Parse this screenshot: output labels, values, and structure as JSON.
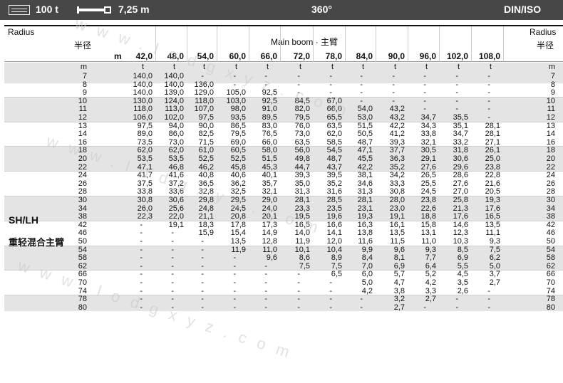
{
  "topbar": {
    "counterweight": "100 t",
    "boom_length": "7,25 m",
    "slewing": "360°",
    "standard": "DIN/ISO"
  },
  "header": {
    "radius_en_left": "Radius",
    "radius_cn_left": "半径",
    "radius_en_right": "Radius",
    "radius_cn_right": "半径",
    "main_boom": "Main boom · 主臂",
    "unit_m": "m",
    "unit_t": "t",
    "boom_lengths": [
      "42,0",
      "48,0",
      "54,0",
      "60,0",
      "66,0",
      "72,0",
      "78,0",
      "84,0",
      "90,0",
      "96,0",
      "102,0",
      "108,0"
    ]
  },
  "side_labels": {
    "config": "SH/LH",
    "config_cn": "重轻混合主臂"
  },
  "watermark": "www.lodgxyz.com",
  "table": {
    "radii": [
      "7",
      "8",
      "9",
      "10",
      "11",
      "12",
      "13",
      "14",
      "16",
      "18",
      "20",
      "22",
      "24",
      "26",
      "28",
      "30",
      "34",
      "38",
      "42",
      "46",
      "50",
      "54",
      "58",
      "62",
      "66",
      "70",
      "74",
      "78",
      "80"
    ],
    "rows": [
      [
        "140,0",
        "140,0",
        "-",
        "-",
        "-",
        "-",
        "-",
        "-",
        "-",
        "-",
        "-",
        "-"
      ],
      [
        "140,0",
        "140,0",
        "136,0",
        "-",
        "-",
        "-",
        "-",
        "-",
        "-",
        "-",
        "-",
        "-"
      ],
      [
        "140,0",
        "139,0",
        "129,0",
        "105,0",
        "92,5",
        "-",
        "-",
        "-",
        "-",
        "-",
        "-",
        "-"
      ],
      [
        "130,0",
        "124,0",
        "118,0",
        "103,0",
        "92,5",
        "84,5",
        "67,0",
        "-",
        "-",
        "-",
        "-",
        "-"
      ],
      [
        "118,0",
        "113,0",
        "107,0",
        "98,0",
        "91,0",
        "82,0",
        "66,0",
        "54,0",
        "43,2",
        "-",
        "-",
        "-"
      ],
      [
        "106,0",
        "102,0",
        "97,5",
        "93,5",
        "89,5",
        "79,5",
        "65,5",
        "53,0",
        "43,2",
        "34,7",
        "35,5",
        "-"
      ],
      [
        "97,5",
        "94,0",
        "90,0",
        "86,5",
        "83,0",
        "76,0",
        "63,5",
        "51,5",
        "42,2",
        "34,3",
        "35,1",
        "28,1"
      ],
      [
        "89,0",
        "86,0",
        "82,5",
        "79,5",
        "76,5",
        "73,0",
        "62,0",
        "50,5",
        "41,2",
        "33,8",
        "34,7",
        "28,1"
      ],
      [
        "73,5",
        "73,0",
        "71,5",
        "69,0",
        "66,0",
        "63,5",
        "58,5",
        "48,7",
        "39,3",
        "32,1",
        "33,2",
        "27,1"
      ],
      [
        "62,0",
        "62,0",
        "61,0",
        "60,5",
        "58,0",
        "56,0",
        "54,5",
        "47,1",
        "37,7",
        "30,5",
        "31,8",
        "26,1"
      ],
      [
        "53,5",
        "53,5",
        "52,5",
        "52,5",
        "51,5",
        "49,8",
        "48,7",
        "45,5",
        "36,3",
        "29,1",
        "30,6",
        "25,0"
      ],
      [
        "47,1",
        "46,8",
        "46,2",
        "45,8",
        "45,3",
        "44,7",
        "43,7",
        "42,2",
        "35,2",
        "27,6",
        "29,6",
        "23,8"
      ],
      [
        "41,7",
        "41,6",
        "40,8",
        "40,6",
        "40,1",
        "39,3",
        "39,5",
        "38,1",
        "34,2",
        "26,5",
        "28,6",
        "22,8"
      ],
      [
        "37,5",
        "37,2",
        "36,5",
        "36,2",
        "35,7",
        "35,0",
        "35,2",
        "34,6",
        "33,3",
        "25,5",
        "27,6",
        "21,6"
      ],
      [
        "33,8",
        "33,6",
        "32,8",
        "32,5",
        "32,1",
        "31,3",
        "31,6",
        "31,3",
        "30,8",
        "24,5",
        "27,0",
        "20,5"
      ],
      [
        "30,8",
        "30,6",
        "29,8",
        "29,5",
        "29,0",
        "28,1",
        "28,5",
        "28,1",
        "28,0",
        "23,8",
        "25,8",
        "19,3"
      ],
      [
        "26,0",
        "25,6",
        "24,8",
        "24,5",
        "24,0",
        "23,3",
        "23,5",
        "23,1",
        "23,0",
        "22,6",
        "21,3",
        "17,6"
      ],
      [
        "22,3",
        "22,0",
        "21,1",
        "20,8",
        "20,1",
        "19,5",
        "19,6",
        "19,3",
        "19,1",
        "18,8",
        "17,6",
        "16,5"
      ],
      [
        "-",
        "19,1",
        "18,3",
        "17,8",
        "17,3",
        "16,5",
        "16,6",
        "16,3",
        "16,1",
        "15,8",
        "14,6",
        "13,5"
      ],
      [
        "-",
        "-",
        "15,9",
        "15,4",
        "14,9",
        "14,0",
        "14,1",
        "13,8",
        "13,5",
        "13,1",
        "12,3",
        "11,1"
      ],
      [
        "-",
        "-",
        "-",
        "13,5",
        "12,8",
        "11,9",
        "12,0",
        "11,6",
        "11,5",
        "11,0",
        "10,3",
        "9,3"
      ],
      [
        "-",
        "-",
        "-",
        "11,9",
        "11,0",
        "10,1",
        "10,4",
        "9,9",
        "9,6",
        "9,3",
        "8,5",
        "7,5"
      ],
      [
        "-",
        "-",
        "-",
        "-",
        "9,6",
        "8,6",
        "8,9",
        "8,4",
        "8,1",
        "7,7",
        "6,9",
        "6,2"
      ],
      [
        "-",
        "-",
        "-",
        "-",
        "-",
        "7,5",
        "7,5",
        "7,0",
        "6,9",
        "6,4",
        "5,5",
        "5,0"
      ],
      [
        "-",
        "-",
        "-",
        "-",
        "-",
        "-",
        "6,5",
        "6,0",
        "5,7",
        "5,2",
        "4,5",
        "3,7"
      ],
      [
        "-",
        "-",
        "-",
        "-",
        "-",
        "-",
        "-",
        "5,0",
        "4,7",
        "4,2",
        "3,5",
        "2,7"
      ],
      [
        "-",
        "-",
        "-",
        "-",
        "-",
        "-",
        "-",
        "4,2",
        "3,8",
        "3,3",
        "2,6",
        "-"
      ],
      [
        "-",
        "-",
        "-",
        "-",
        "-",
        "-",
        "-",
        "-",
        "3,2",
        "2,7",
        "-",
        "-"
      ],
      [
        "-",
        "-",
        "-",
        "-",
        "-",
        "-",
        "-",
        "-",
        "2,7",
        "-",
        "-",
        "-"
      ]
    ]
  }
}
